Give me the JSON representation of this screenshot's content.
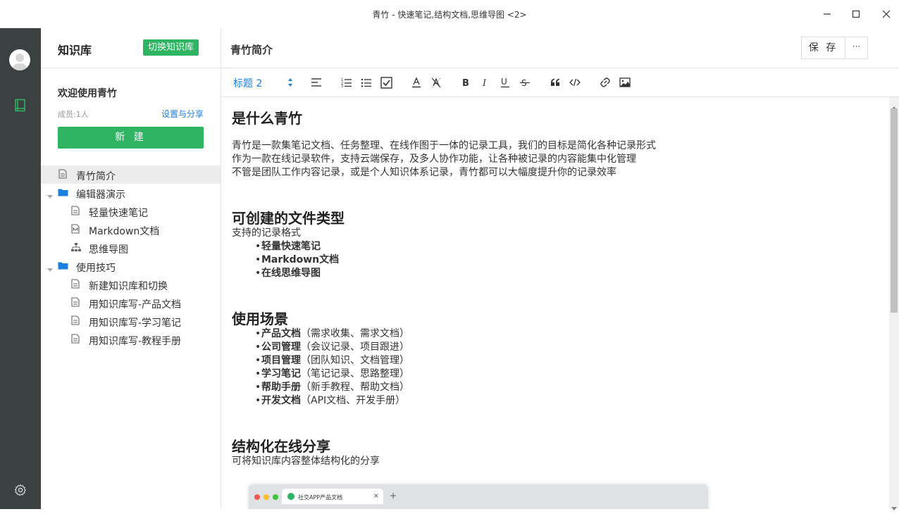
{
  "window": {
    "title": "青竹 - 快速笔记,结构文档,思维导图 <2>"
  },
  "sidebar": {
    "kb_title": "知识库",
    "switch_label": "切换知识库",
    "welcome": "欢迎使用青竹",
    "members": "成员:1人",
    "share_label": "设置与分享",
    "new_label": "新 建",
    "tree": [
      {
        "label": "青竹简介",
        "icon": "doc-icon",
        "level": 0,
        "active": true
      },
      {
        "label": "编辑器演示",
        "icon": "folder-icon",
        "level": 0,
        "expanded": true
      },
      {
        "label": "轻量快速笔记",
        "icon": "doc-icon",
        "level": 1
      },
      {
        "label": "Markdown文档",
        "icon": "markdown-doc-icon",
        "level": 1
      },
      {
        "label": "思维导图",
        "icon": "mindmap-icon",
        "level": 1
      },
      {
        "label": "使用技巧",
        "icon": "folder-icon",
        "level": 0,
        "expanded": true
      },
      {
        "label": "新建知识库和切换",
        "icon": "doc-icon",
        "level": 1
      },
      {
        "label": "用知识库写-产品文档",
        "icon": "doc-icon",
        "level": 1
      },
      {
        "label": "用知识库写-学习笔记",
        "icon": "doc-icon",
        "level": 1
      },
      {
        "label": "用知识库写-教程手册",
        "icon": "doc-icon",
        "level": 1
      }
    ]
  },
  "header": {
    "doc_title": "青竹简介",
    "save_label": "保 存",
    "more_label": "···"
  },
  "toolbar": {
    "heading_value": "标题 2"
  },
  "content": {
    "h1": "是什么青竹",
    "intro": [
      "青竹是一款集笔记文档、任务整理、在线作图于一体的记录工具，我们的目标是简化各种记录形式",
      "作为一款在线记录软件，支持云端保存，及多人协作功能，让各种被记录的内容能集中化管理",
      "不管是团队工作内容记录，或是个人知识体系记录，青竹都可以大幅度提升你的记录效率"
    ],
    "h2": "可创建的文件类型",
    "types_intro": "支持的记录格式",
    "types": [
      "轻量快速笔记",
      "Markdown文档",
      "在线思维导图"
    ],
    "h3": "使用场景",
    "scenes": [
      {
        "bold": "产品文档",
        "rest": "（需求收集、需求文档）"
      },
      {
        "bold": "公司管理",
        "rest": "（会议记录、项目跟进）"
      },
      {
        "bold": "项目管理",
        "rest": "（团队知识、文档管理）"
      },
      {
        "bold": "学习笔记",
        "rest": "（笔记记录、思路整理）"
      },
      {
        "bold": "帮助手册",
        "rest": "（新手教程、帮助文档）"
      },
      {
        "bold": "开发文档",
        "rest": "（API文档、开发手册）"
      }
    ],
    "h4": "结构化在线分享",
    "share_text": "可将知识库内容整体结构化的分享",
    "preview_tab": "社交APP产品文档",
    "preview_close": "×",
    "preview_plus": "+"
  },
  "colors": {
    "accent_green": "#2fb463",
    "link_blue": "#1a7fe0",
    "rail_bg": "#3b4141"
  }
}
